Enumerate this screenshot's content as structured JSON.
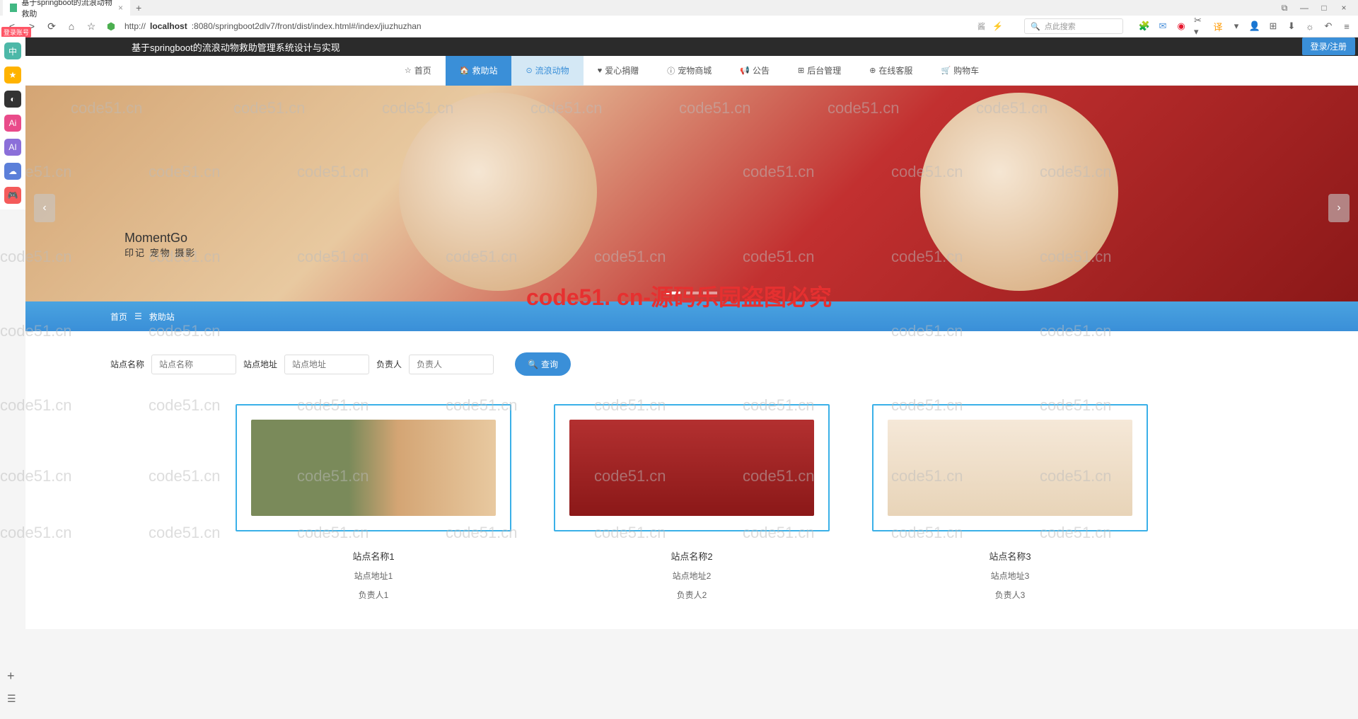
{
  "browser": {
    "tab_title": "基于springboot的流浪动物救助",
    "url_prefix": "http://",
    "url_host": "localhost",
    "url_path": ":8080/springboot2dlv7/front/dist/index.html#/index/jiuzhuzhan",
    "search_placeholder": "点此搜索",
    "login_badge": "登录账号"
  },
  "header": {
    "site_title": "基于springboot的流浪动物救助管理系统设计与实现",
    "login_register": "登录/注册"
  },
  "nav": {
    "items": [
      {
        "icon": "☆",
        "label": "首页"
      },
      {
        "icon": "🏠",
        "label": "救助站"
      },
      {
        "icon": "⊙",
        "label": "流浪动物"
      },
      {
        "icon": "♥",
        "label": "爱心捐赠"
      },
      {
        "icon": "ⓘ",
        "label": "宠物商城"
      },
      {
        "icon": "📢",
        "label": "公告"
      },
      {
        "icon": "⊞",
        "label": "后台管理"
      },
      {
        "icon": "⊕",
        "label": "在线客服"
      },
      {
        "icon": "🛒",
        "label": "购物车"
      }
    ]
  },
  "banner": {
    "logo_main": "MomentGo",
    "logo_sub": "印记 宠物 摄影"
  },
  "breadcrumb": {
    "home": "首页",
    "sep": "☰",
    "current": "救助站"
  },
  "search": {
    "label_name": "站点名称",
    "placeholder_name": "站点名称",
    "label_addr": "站点地址",
    "placeholder_addr": "站点地址",
    "label_person": "负责人",
    "placeholder_person": "负责人",
    "query": "查询"
  },
  "cards": [
    {
      "title": "站点名称1",
      "addr": "站点地址1",
      "person": "负责人1"
    },
    {
      "title": "站点名称2",
      "addr": "站点地址2",
      "person": "负责人2"
    },
    {
      "title": "站点名称3",
      "addr": "站点地址3",
      "person": "负责人3"
    }
  ],
  "watermark": {
    "text": "code51.cn",
    "big": "code51. cn-源码乐园盗图必究"
  }
}
